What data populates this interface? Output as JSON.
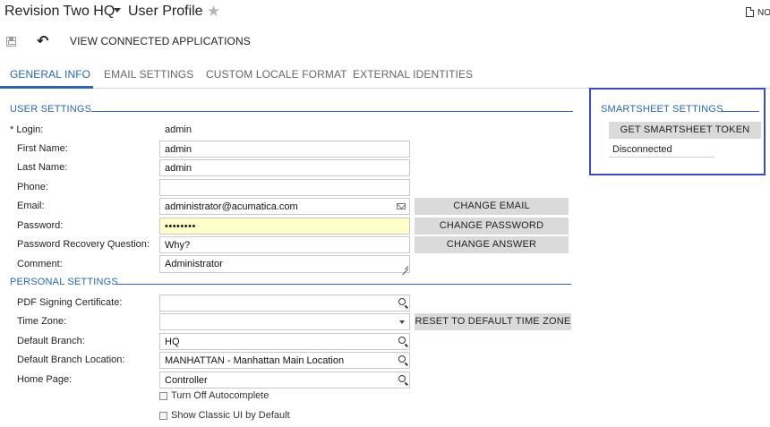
{
  "header": {
    "company": "Revision Two HQ",
    "screen_title": "User Profile",
    "notes_label": "NO"
  },
  "icons": {
    "save": "save-icon",
    "undo": "undo-icon",
    "favorite": "star-icon",
    "notes": "document-icon"
  },
  "toolbar": {
    "view_connected_label": "VIEW CONNECTED APPLICATIONS"
  },
  "tabs": [
    {
      "label": "GENERAL INFO",
      "active": true
    },
    {
      "label": "EMAIL SETTINGS",
      "active": false
    },
    {
      "label": "CUSTOM LOCALE FORMAT",
      "active": false
    },
    {
      "label": "EXTERNAL IDENTITIES",
      "active": false
    }
  ],
  "user_settings": {
    "title": "USER SETTINGS",
    "login_label": "* Login:",
    "login_value": "admin",
    "first_name_label": "First Name:",
    "first_name_value": "admin",
    "last_name_label": "Last Name:",
    "last_name_value": "admin",
    "phone_label": "Phone:",
    "phone_value": "",
    "email_label": "Email:",
    "email_value": "administrator@acumatica.com",
    "password_label": "Password:",
    "password_value": "••••••••",
    "recovery_label": "Password Recovery Question:",
    "recovery_value": "Why?",
    "comment_label": "Comment:",
    "comment_value": "Administrator",
    "change_email_label": "CHANGE EMAIL",
    "change_password_label": "CHANGE PASSWORD",
    "change_answer_label": "CHANGE ANSWER"
  },
  "personal_settings": {
    "title": "PERSONAL SETTINGS",
    "pdf_label": "PDF Signing Certificate:",
    "pdf_value": "",
    "timezone_label": "Time Zone:",
    "timezone_value": "",
    "reset_timezone_label": "RESET TO DEFAULT TIME ZONE",
    "branch_label": "Default Branch:",
    "branch_value": "HQ",
    "branch_location_label": "Default Branch Location:",
    "branch_location_value": "MANHATTAN - Manhattan Main Location",
    "home_page_label": "Home Page:",
    "home_page_value": "Controller",
    "autocomplete_label": "Turn Off Autocomplete",
    "autocomplete_checked": false,
    "classic_ui_label": "Show Classic UI by Default",
    "classic_ui_checked": false
  },
  "smartsheet": {
    "title": "SMARTSHEET SETTINGS",
    "token_button_label": "GET SMARTSHEET TOKEN",
    "status": "Disconnected"
  },
  "colors": {
    "accent": "#2967a8",
    "highlight_border": "#3b4bc0",
    "password_bg": "#ffffcc",
    "button_bg": "#dadada"
  }
}
